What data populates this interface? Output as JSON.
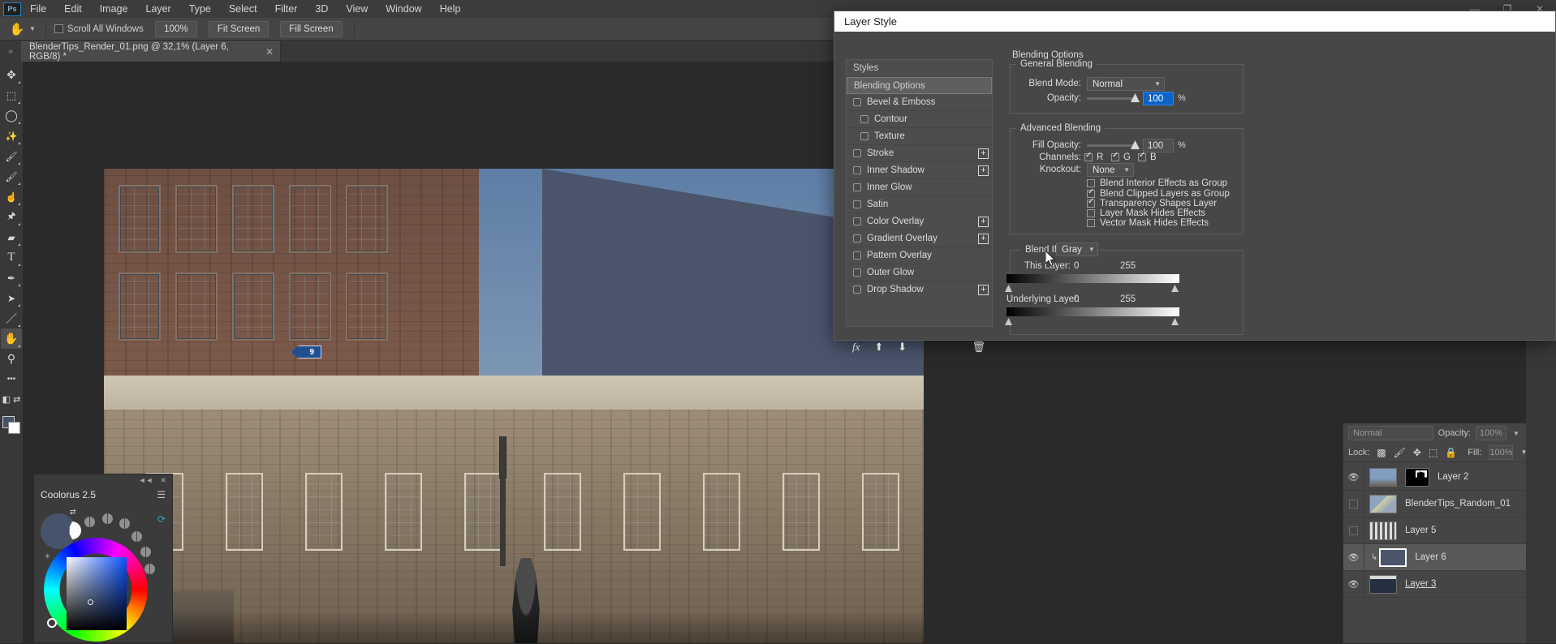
{
  "app": {
    "logo": "Ps"
  },
  "menubar": {
    "items": [
      "File",
      "Edit",
      "Image",
      "Layer",
      "Type",
      "Select",
      "Filter",
      "3D",
      "View",
      "Window",
      "Help"
    ],
    "window_controls": [
      "—",
      "❐",
      "✕"
    ]
  },
  "options_bar": {
    "tool_icon": "hand-tool",
    "scroll_all_windows": {
      "label": "Scroll All Windows",
      "checked": false
    },
    "buttons": [
      "100%",
      "Fit Screen",
      "Fill Screen"
    ]
  },
  "tab_bar": {
    "collapse_icon": "»",
    "document_tab": {
      "title": "BlenderTips_Render_01.png @ 32,1% (Layer 6, RGB/8) *",
      "close": "✕"
    }
  },
  "toolbar": {
    "tools": [
      {
        "name": "move-tool",
        "glyph": "✥"
      },
      {
        "name": "marquee-tool",
        "glyph": "▭"
      },
      {
        "name": "lasso-tool",
        "glyph": "◯"
      },
      {
        "name": "magic-wand-tool",
        "glyph": "✦"
      },
      {
        "name": "brush-tool",
        "glyph": "🖌"
      },
      {
        "name": "mixer-brush-tool",
        "glyph": "🖌"
      },
      {
        "name": "smudge-tool",
        "glyph": "☝"
      },
      {
        "name": "clone-stamp-tool",
        "glyph": "⚱"
      },
      {
        "name": "eraser-tool",
        "glyph": "▰"
      },
      {
        "name": "type-tool",
        "glyph": "T"
      },
      {
        "name": "pen-tool",
        "glyph": "✎"
      },
      {
        "name": "path-selection-tool",
        "glyph": "➤"
      },
      {
        "name": "line-tool",
        "glyph": "／"
      },
      {
        "name": "hand-tool",
        "glyph": "✋"
      },
      {
        "name": "zoom-tool",
        "glyph": "⚲"
      },
      {
        "name": "more-tools",
        "glyph": "•••"
      },
      {
        "name": "quick-mask-tool",
        "glyph": "◧"
      }
    ],
    "active_tool": "hand-tool",
    "foreground_color": "#47536b",
    "background_color": "#ffffff"
  },
  "canvas": {
    "sign_label": "9",
    "zoom_level": "32,1%"
  },
  "coolorus": {
    "title": "Coolorus 2.5",
    "collapse_icon": "◄◄",
    "close_icon": "✕",
    "menu_icon": "☰",
    "swap_icon": "⇄",
    "brightness_icon": "☀",
    "refresh_icon": "⟳",
    "current_color": "#47536b"
  },
  "layers_panel": {
    "blend_mode": "Normal",
    "opacity_label": "Opacity:",
    "opacity_value": "100%",
    "lock_label": "Lock:",
    "lock_icons": [
      "▩",
      "🖌",
      "✥",
      "▢",
      "🔒"
    ],
    "fill_label": "Fill:",
    "fill_value": "100%",
    "layers": [
      {
        "name": "Layer 2",
        "visible": true,
        "selected": false,
        "has_mask": true,
        "clipped": false
      },
      {
        "name": "BlenderTips_Random_01",
        "visible": false,
        "selected": false,
        "has_mask": false,
        "clipped": false
      },
      {
        "name": "Layer 5",
        "visible": false,
        "selected": false,
        "has_mask": false,
        "clipped": false
      },
      {
        "name": "Layer 6",
        "visible": true,
        "selected": true,
        "has_mask": false,
        "clipped": true
      },
      {
        "name": "Layer 3",
        "visible": true,
        "selected": false,
        "has_mask": false,
        "clipped": false
      }
    ]
  },
  "layer_style": {
    "title": "Layer Style",
    "styles_list": [
      {
        "label": "Styles",
        "type": "header",
        "checkbox": false,
        "plus": false,
        "indent": false,
        "selected": false
      },
      {
        "label": "Blending Options",
        "type": "header",
        "checkbox": false,
        "plus": false,
        "indent": false,
        "selected": true
      },
      {
        "label": "Bevel & Emboss",
        "type": "effect",
        "checkbox": true,
        "checked": false,
        "plus": false,
        "indent": false,
        "selected": false
      },
      {
        "label": "Contour",
        "type": "effect",
        "checkbox": true,
        "checked": false,
        "plus": false,
        "indent": true,
        "selected": false
      },
      {
        "label": "Texture",
        "type": "effect",
        "checkbox": true,
        "checked": false,
        "plus": false,
        "indent": true,
        "selected": false
      },
      {
        "label": "Stroke",
        "type": "effect",
        "checkbox": true,
        "checked": false,
        "plus": true,
        "indent": false,
        "selected": false
      },
      {
        "label": "Inner Shadow",
        "type": "effect",
        "checkbox": true,
        "checked": false,
        "plus": true,
        "indent": false,
        "selected": false
      },
      {
        "label": "Inner Glow",
        "type": "effect",
        "checkbox": true,
        "checked": false,
        "plus": false,
        "indent": false,
        "selected": false
      },
      {
        "label": "Satin",
        "type": "effect",
        "checkbox": true,
        "checked": false,
        "plus": false,
        "indent": false,
        "selected": false
      },
      {
        "label": "Color Overlay",
        "type": "effect",
        "checkbox": true,
        "checked": false,
        "plus": true,
        "indent": false,
        "selected": false
      },
      {
        "label": "Gradient Overlay",
        "type": "effect",
        "checkbox": true,
        "checked": false,
        "plus": true,
        "indent": false,
        "selected": false
      },
      {
        "label": "Pattern Overlay",
        "type": "effect",
        "checkbox": true,
        "checked": false,
        "plus": false,
        "indent": false,
        "selected": false
      },
      {
        "label": "Outer Glow",
        "type": "effect",
        "checkbox": true,
        "checked": false,
        "plus": false,
        "indent": false,
        "selected": false
      },
      {
        "label": "Drop Shadow",
        "type": "effect",
        "checkbox": true,
        "checked": false,
        "plus": true,
        "indent": false,
        "selected": false
      }
    ],
    "footer": {
      "fx_icon": "fx",
      "up_icon": "⬆",
      "down_icon": "⬇",
      "trash_icon": "🗑"
    },
    "blending_options_label": "Blending Options",
    "general_blending": {
      "group_label": "General Blending",
      "blend_mode_label": "Blend Mode:",
      "blend_mode_value": "Normal",
      "opacity_label": "Opacity:",
      "opacity_value": "100",
      "opacity_unit": "%"
    },
    "advanced_blending": {
      "group_label": "Advanced Blending",
      "fill_opacity_label": "Fill Opacity:",
      "fill_opacity_value": "100",
      "fill_opacity_unit": "%",
      "channels_label": "Channels:",
      "channels": [
        {
          "label": "R",
          "checked": true
        },
        {
          "label": "G",
          "checked": true
        },
        {
          "label": "B",
          "checked": true
        }
      ],
      "knockout_label": "Knockout:",
      "knockout_value": "None",
      "options": [
        {
          "label": "Blend Interior Effects as Group",
          "checked": false
        },
        {
          "label": "Blend Clipped Layers as Group",
          "checked": true
        },
        {
          "label": "Transparency Shapes Layer",
          "checked": true
        },
        {
          "label": "Layer Mask Hides Effects",
          "checked": false
        },
        {
          "label": "Vector Mask Hides Effects",
          "checked": false
        }
      ]
    },
    "blend_if": {
      "label": "Blend If:",
      "channel_value": "Gray",
      "this_layer": {
        "label": "This Layer:",
        "min": "0",
        "max": "255"
      },
      "underlying_layer": {
        "label": "Underlying Layer:",
        "min": "0",
        "max": "255"
      }
    }
  }
}
